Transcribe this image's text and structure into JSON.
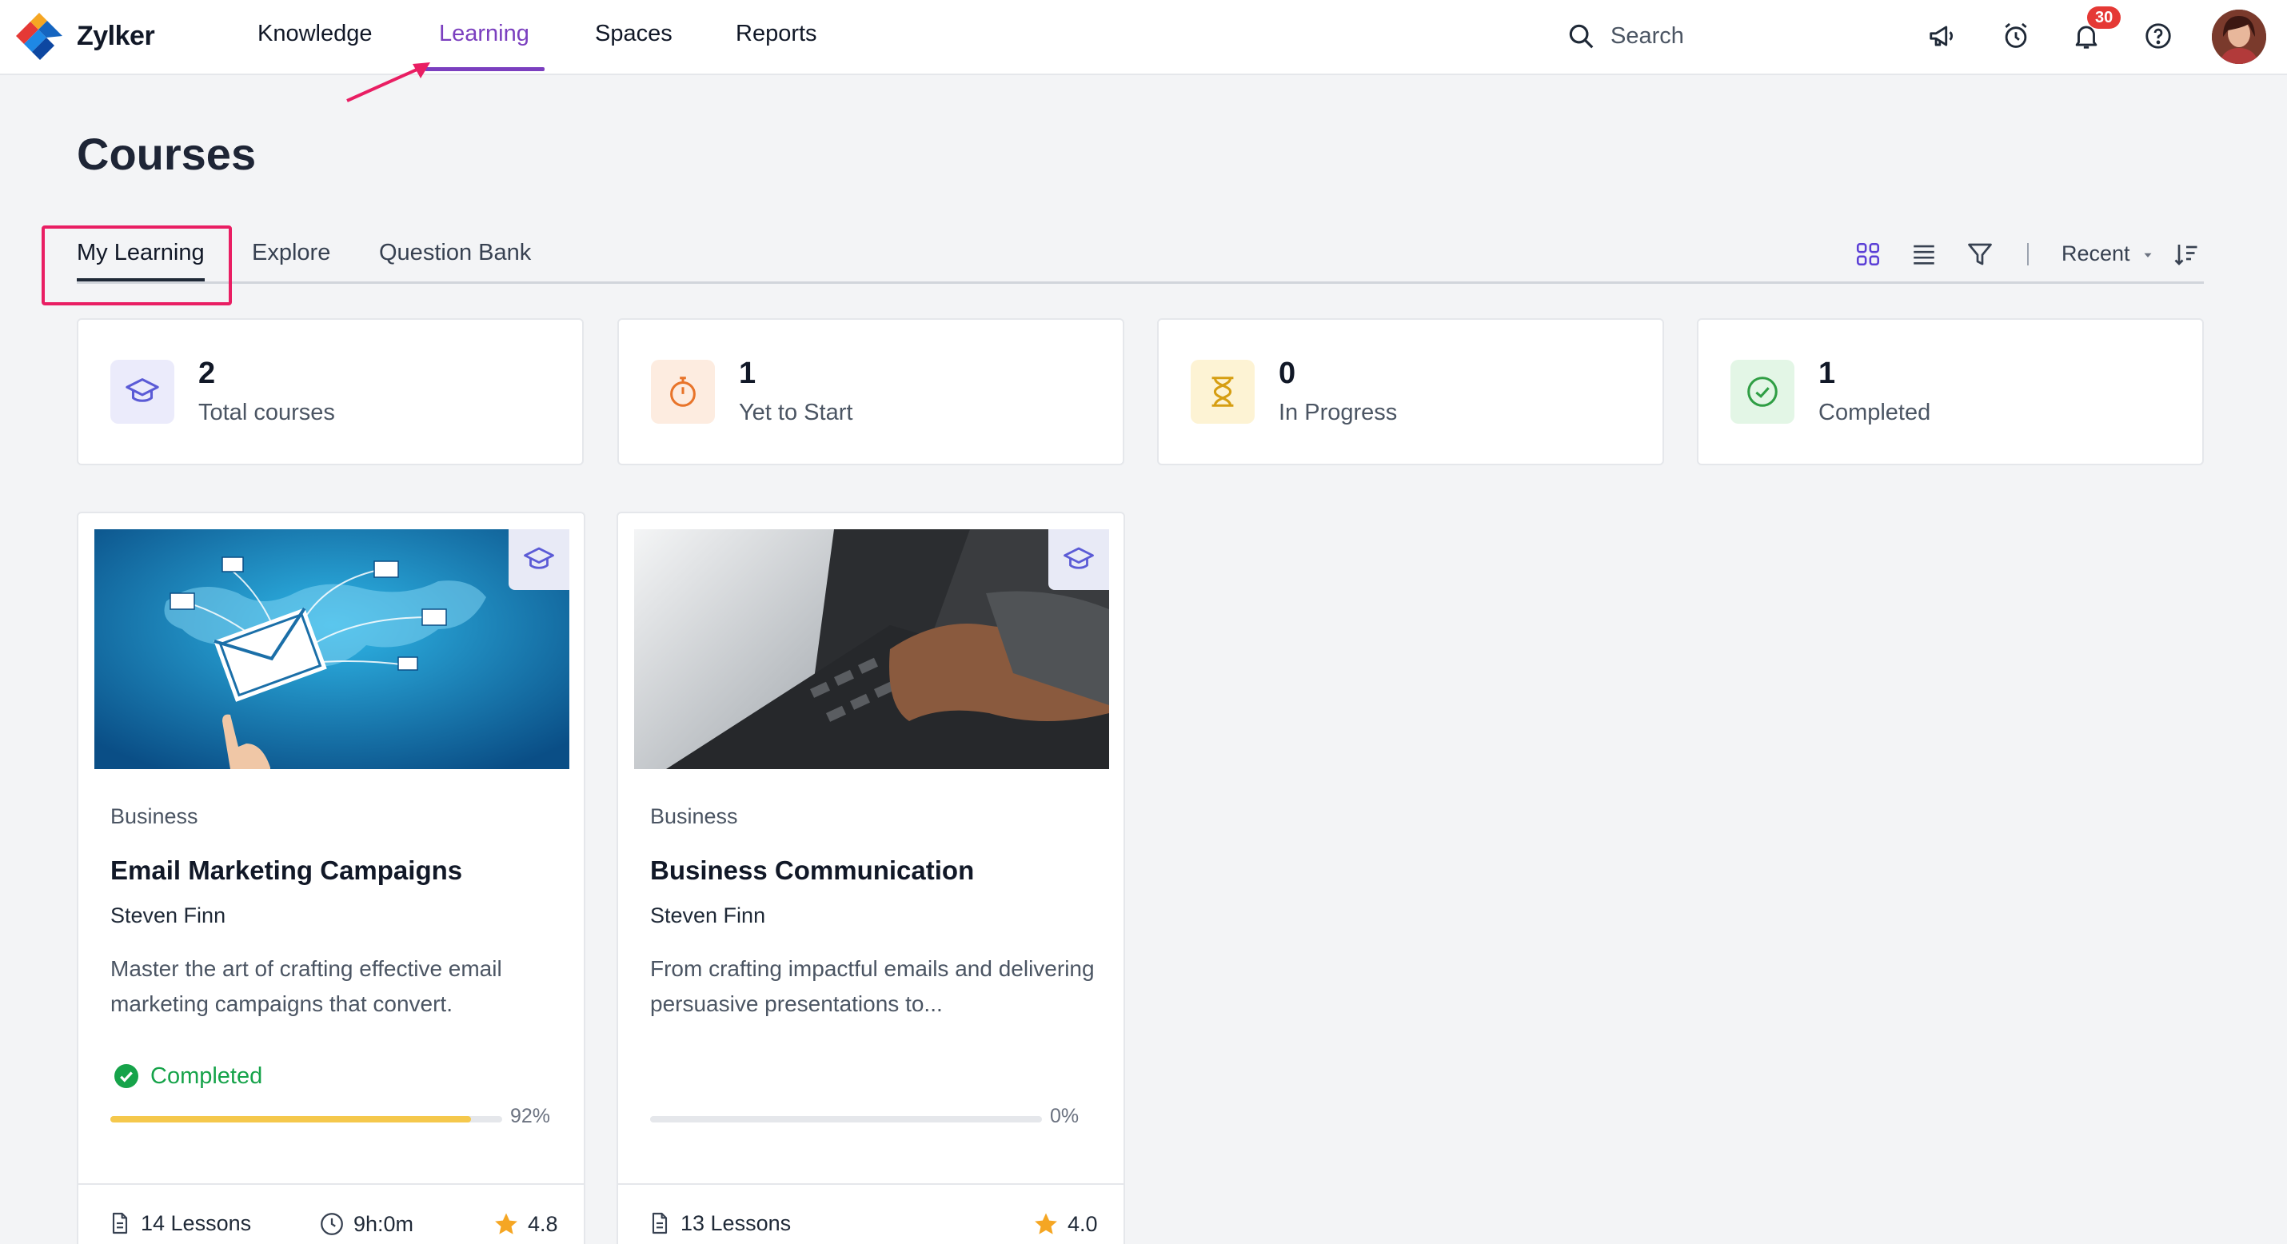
{
  "app": {
    "name": "Zylker"
  },
  "nav": [
    {
      "label": "Knowledge",
      "active": false
    },
    {
      "label": "Learning",
      "active": true
    },
    {
      "label": "Spaces",
      "active": false
    },
    {
      "label": "Reports",
      "active": false
    }
  ],
  "search": {
    "placeholder": "Search"
  },
  "header_icons": {
    "announcement": "megaphone-icon",
    "reminder": "alarm-clock-icon",
    "notifications": "bell-icon",
    "help": "help-icon",
    "notification_count": "30"
  },
  "page": {
    "title": "Courses"
  },
  "tabs": [
    {
      "label": "My Learning",
      "active": true
    },
    {
      "label": "Explore",
      "active": false
    },
    {
      "label": "Question Bank",
      "active": false
    }
  ],
  "toolbar": {
    "sort_label": "Recent"
  },
  "stats": [
    {
      "value": "2",
      "label": "Total courses",
      "icon": "graduation-cap-icon",
      "color": "#5b5bd6",
      "bg": "#ebebfb"
    },
    {
      "value": "1",
      "label": "Yet to Start",
      "icon": "stopwatch-icon",
      "color": "#e8742a",
      "bg": "#fdece0"
    },
    {
      "value": "0",
      "label": "In Progress",
      "icon": "hourglass-icon",
      "color": "#d69e12",
      "bg": "#fdf3d4"
    },
    {
      "value": "1",
      "label": "Completed",
      "icon": "check-circle-icon",
      "color": "#2f9e44",
      "bg": "#e3f6e6"
    }
  ],
  "courses": [
    {
      "category": "Business",
      "title": "Email Marketing Campaigns",
      "author": "Steven Finn",
      "description": "Master the art of crafting effective email marketing campaigns that convert.",
      "status": "Completed",
      "progress": 0.92,
      "progress_label": "92%",
      "lessons": "14 Lessons",
      "duration": "9h:0m",
      "rating": "4.8"
    },
    {
      "category": "Business",
      "title": "Business Communication",
      "author": "Steven Finn",
      "description": "From crafting impactful emails and delivering persuasive presentations to...",
      "status": "",
      "progress": 0,
      "progress_label": "0%",
      "lessons": "13 Lessons",
      "duration": "",
      "rating": "4.0"
    }
  ],
  "colors": {
    "accent": "#7b3fbf",
    "highlight": "#e91e63",
    "star": "#f5a623",
    "success": "#16a34a"
  }
}
